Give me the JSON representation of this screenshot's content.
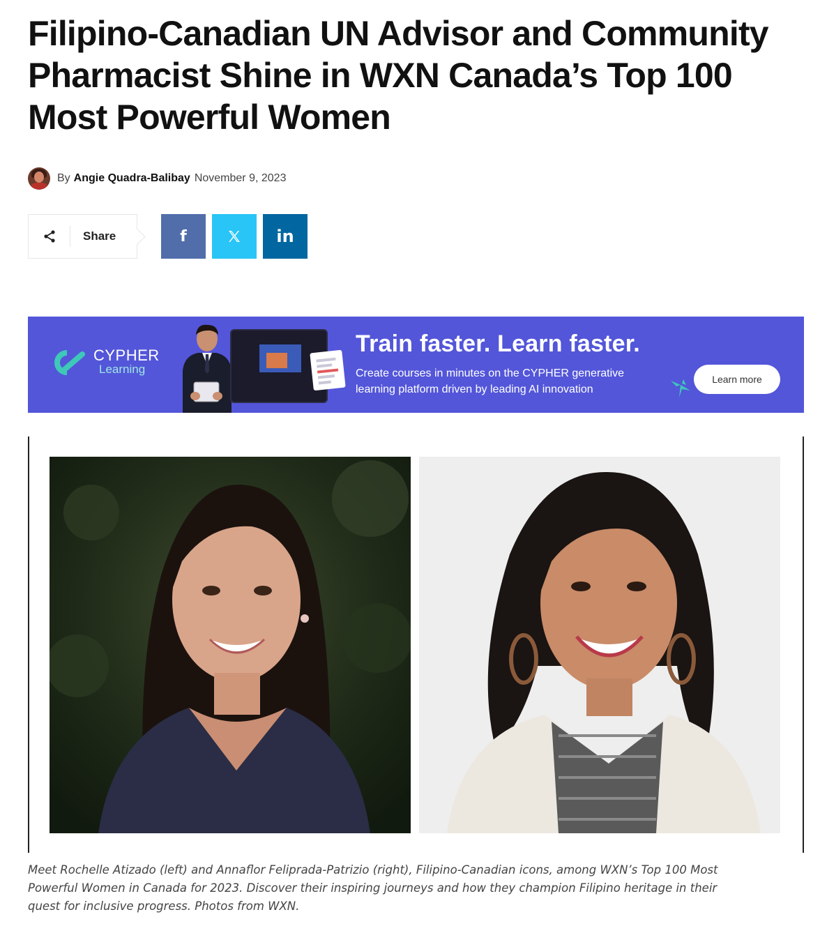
{
  "article": {
    "title_lines": [
      "Filipino-Canadian UN Advisor and Community",
      "Pharmacist Shine in WXN Canada’s Top 100",
      "Most Powerful Women"
    ],
    "byline": {
      "prefix": "By",
      "author": "Angie Quadra-Balibay",
      "date": "November 9, 2023"
    },
    "share": {
      "label": "Share",
      "buttons": [
        {
          "network": "facebook",
          "glyph": "f",
          "color": "#516eab",
          "icon": "facebook-icon"
        },
        {
          "network": "x",
          "glyph": "𝕏",
          "color": "#29c5f6",
          "icon": "x-icon"
        },
        {
          "network": "linkedin",
          "glyph": "in",
          "color": "#0266a0",
          "icon": "linkedin-icon"
        }
      ]
    },
    "caption_lines": [
      "Meet Rochelle Atizado (left) and Annaflor Feliprada-Patrizio (right), Filipino-Canadian icons, among WXN’s Top 100 Most",
      "Powerful Women in Canada for 2023. Discover their inspiring journeys and how they champion Filipino heritage in their",
      "quest for inclusive progress. Photos from WXN."
    ]
  },
  "ad": {
    "brand_name": "CYPHER",
    "brand_sub": "Learning",
    "headline": "Train faster. Learn faster.",
    "sub_lines": [
      "Create courses in minutes on the CYPHER generative",
      "learning platform driven by leading AI innovation"
    ],
    "cta": "Learn more",
    "background": "#5356d9",
    "accent": "#3ec8b8"
  }
}
